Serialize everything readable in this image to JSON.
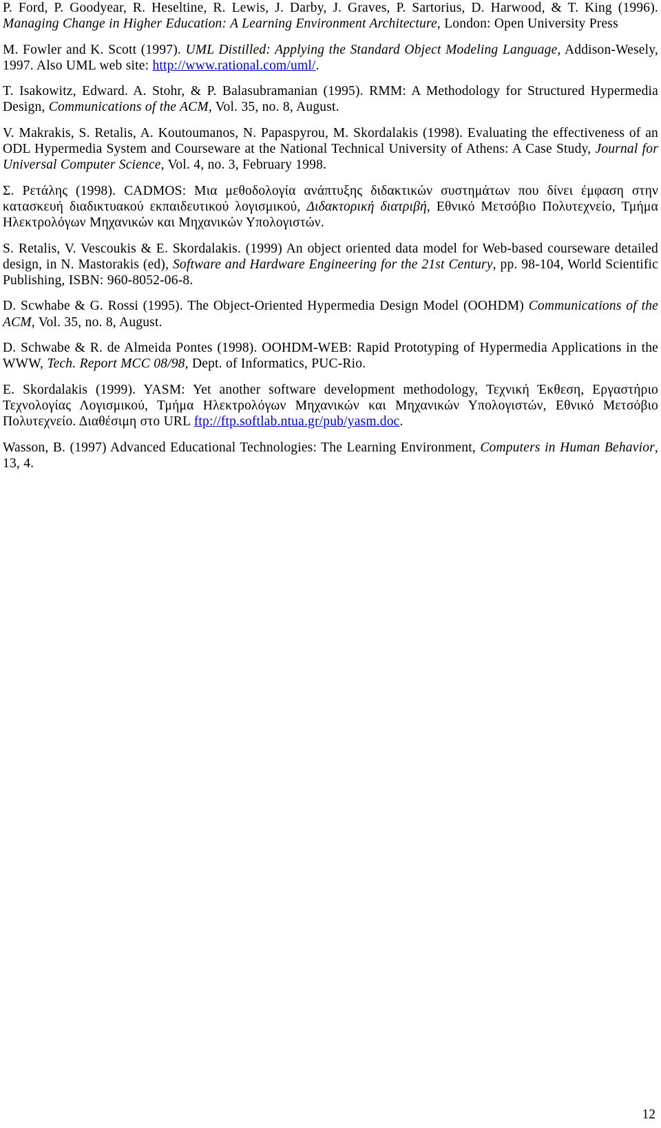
{
  "document": {
    "type": "academic-references-page",
    "page_number": "12",
    "language_mix": [
      "English",
      "Greek"
    ],
    "link_color": "#0000c0",
    "text_color": "#000000",
    "background_color": "#ffffff"
  },
  "references": [
    {
      "id": "ford-1996",
      "parts": [
        {
          "text": "P. Ford, P. Goodyear, R. Heseltine, R. Lewis, J. Darby, J. Graves, P. Sartorius, D. Harwood, & T. King (1996). ",
          "style": "normal"
        },
        {
          "text": "Managing Change in Higher Education: A Learning Environment Architecture",
          "style": "italic"
        },
        {
          "text": ", London: Open University Press",
          "style": "normal"
        }
      ]
    },
    {
      "id": "fowler-1997",
      "parts": [
        {
          "text": "M. Fowler and K. Scott (1997). ",
          "style": "normal"
        },
        {
          "text": "UML Distilled: Applying the Standard Object Modeling Language",
          "style": "italic"
        },
        {
          "text": ", Addison-Wesely, 1997. Also UML web site: ",
          "style": "normal"
        },
        {
          "text": "http://www.rational.com/uml/",
          "style": "link"
        },
        {
          "text": ".",
          "style": "normal"
        }
      ]
    },
    {
      "id": "isakowitz-1995",
      "parts": [
        {
          "text": "T. Isakowitz, Edward. A. Stohr, & P. Balasubramanian (1995). RMM: A Methodology for Structured Hypermedia Design, ",
          "style": "normal"
        },
        {
          "text": "Communications of the ACM",
          "style": "italic"
        },
        {
          "text": ", Vol. 35, no. 8, August.",
          "style": "normal"
        }
      ]
    },
    {
      "id": "makrakis-1998",
      "parts": [
        {
          "text": "V. Makrakis, S. Retalis, A. Koutoumanos, N. Papaspyrou, M. Skordalakis (1998). Evaluating the effectiveness of an ODL Hypermedia System and Courseware at the National Technical University of Athens: A Case Study, ",
          "style": "normal"
        },
        {
          "text": "Journal for Universal Computer Science",
          "style": "italic"
        },
        {
          "text": ", Vol. 4, no. 3, February 1998.",
          "style": "normal"
        }
      ]
    },
    {
      "id": "retalis-1998-greek",
      "parts": [
        {
          "text": "Σ. Ρετάλης (1998). CADMOS: Μια μεθοδολογία ανάπτυξης διδακτικών συστημάτων που δίνει έμφαση στην κατασκευή διαδικτυακού εκπαιδευτικού λογισμικού, ",
          "style": "normal"
        },
        {
          "text": "Διδακτορική διατριβή",
          "style": "italic"
        },
        {
          "text": ", Εθνικό Μετσόβιο Πολυτεχνείο, Τμήμα Ηλεκτρολόγων Μηχανικών και Μηχανικών Υπολογιστών.",
          "style": "normal"
        }
      ]
    },
    {
      "id": "retalis-1999",
      "parts": [
        {
          "text": "S. Retalis, V. Vescoukis & E. Skordalakis. (1999) An object oriented data model for Web-based courseware detailed design, in N. Mastorakis (ed), ",
          "style": "normal"
        },
        {
          "text": "Software and Hardware Engineering for the 21st Century",
          "style": "italic"
        },
        {
          "text": ", pp. 98-104, World Scientific Publishing, ISBN: 960-8052-06-8.",
          "style": "normal"
        }
      ]
    },
    {
      "id": "scwhabe-1995",
      "parts": [
        {
          "text": "D. Scwhabe & G. Rossi (1995). The Object-Oriented Hypermedia Design Model (OOHDM) ",
          "style": "normal"
        },
        {
          "text": "Communications of the ACM,",
          "style": "italic"
        },
        {
          "text": " Vol. 35, no. 8, August.",
          "style": "normal"
        }
      ]
    },
    {
      "id": "schwabe-1998",
      "parts": [
        {
          "text": "D. Schwabe & R. de Almeida Pontes (1998). OOHDM-WEB: Rapid Prototyping of Hypermedia Applications in the WWW, ",
          "style": "normal"
        },
        {
          "text": "Tech. Report MCC 08/98",
          "style": "italic"
        },
        {
          "text": ", Dept. of Informatics, PUC-Rio.",
          "style": "normal"
        }
      ]
    },
    {
      "id": "skordalakis-1999",
      "parts": [
        {
          "text": "E. Skordalakis (1999). YASM: Yet another software development methodology, Τεχνική Έκθεση, Εργαστήριο Τεχνολογίας Λογισμικού, Τμήμα Ηλεκτρολόγων Μηχανικών και Μηχανικών Υπολογιστών, Εθνικό Μετσόβιο Πολυτεχνείο. Διαθέσιμη στο URL ",
          "style": "normal"
        },
        {
          "text": "ftp://ftp.softlab.ntua.gr/pub/yasm.doc",
          "style": "link"
        },
        {
          "text": ".",
          "style": "normal"
        }
      ]
    },
    {
      "id": "wasson-1997",
      "parts": [
        {
          "text": "Wasson, B. (1997) Advanced Educational Technologies: The Learning Environment, ",
          "style": "normal"
        },
        {
          "text": "Computers in Human Behavior",
          "style": "italic"
        },
        {
          "text": ", 13, 4.",
          "style": "normal"
        }
      ]
    }
  ]
}
